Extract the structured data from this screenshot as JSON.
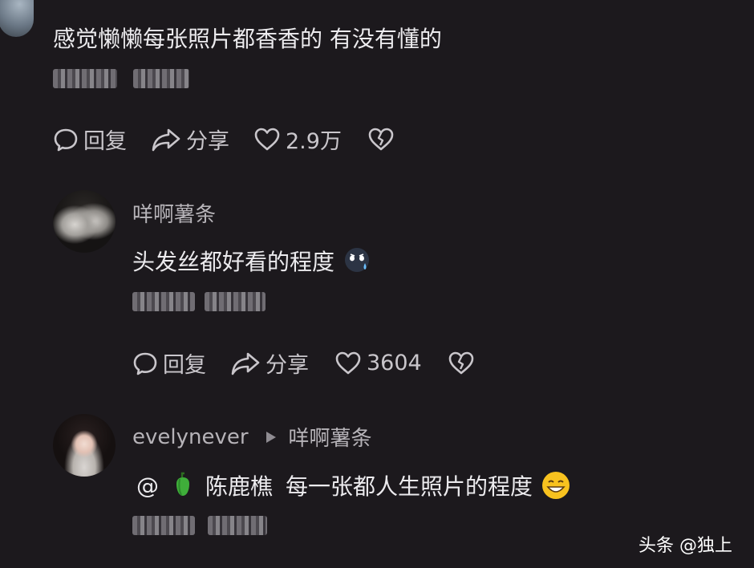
{
  "comment1": {
    "text": "感觉懒懒每张照片都香香的 有没有懂的",
    "actions": {
      "reply": "回复",
      "share": "分享",
      "likes": "2.9万"
    }
  },
  "comment2": {
    "username": "咩啊薯条",
    "text": "头发丝都好看的程度",
    "actions": {
      "reply": "回复",
      "share": "分享",
      "likes": "3604"
    }
  },
  "comment3": {
    "username": "evelynever",
    "reply_to": "咩啊薯条",
    "mention_at": "@",
    "mention_name": "陈鹿樵",
    "text": "每一张都人生照片的程度"
  },
  "watermark": "头条 @独上",
  "colors": {
    "background": "#1c191d",
    "primary_text": "#ecebee",
    "secondary_text": "#b6b3b8",
    "action_text": "#c9c6cb"
  },
  "icons": [
    "comment-bubble-icon",
    "share-arrow-icon",
    "heart-icon",
    "broken-heart-icon",
    "sad-emoji-icon",
    "pepper-emoji-icon",
    "grin-emoji-icon",
    "triangle-right-icon"
  ]
}
